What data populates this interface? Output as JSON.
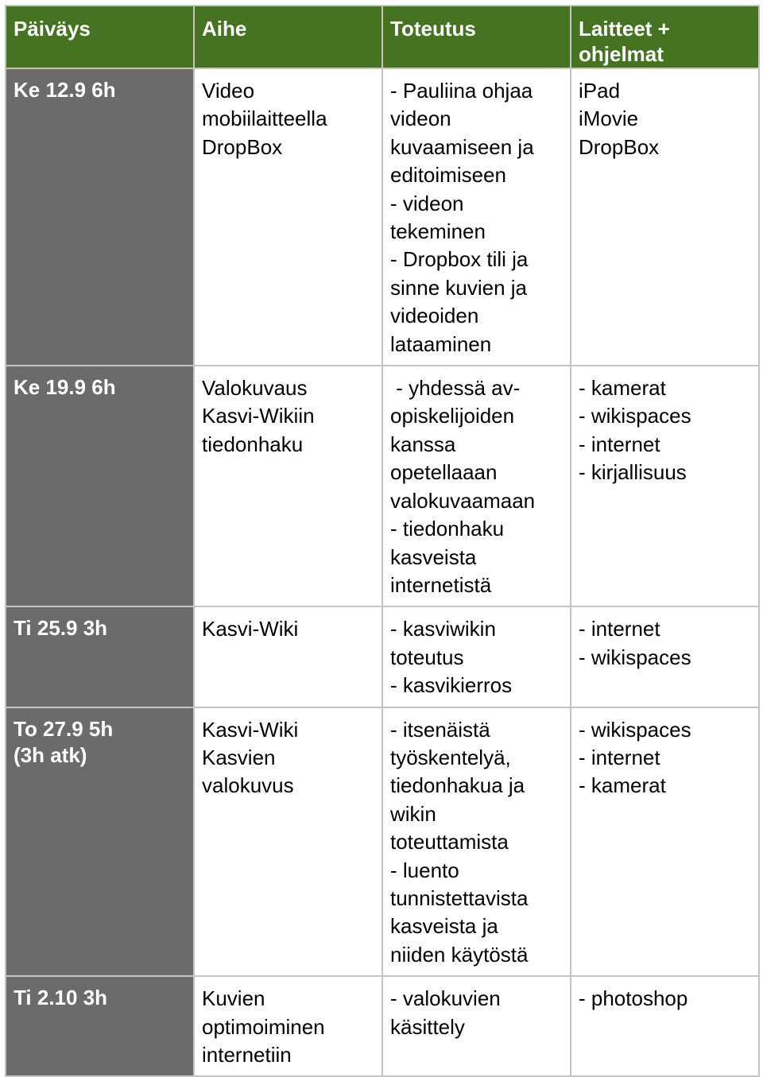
{
  "colors": {
    "header_bg": "#467321",
    "date_column_bg": "#6b6b6b",
    "border": "#c4c4c4"
  },
  "table": {
    "headers": [
      "Päiväys",
      "Aihe",
      "Toteutus",
      "Laitteet + ohjelmat"
    ],
    "rows": [
      {
        "date": [
          "Ke 12.9 6h"
        ],
        "topic": [
          "Video",
          "mobiilaitteella",
          "DropBox"
        ],
        "implementation": [
          "- Pauliina ohjaa",
          "videon",
          "kuvaamiseen ja",
          "editoimiseen",
          "- videon",
          "tekeminen",
          "- Dropbox tili ja",
          "sinne kuvien ja",
          "videoiden",
          "lataaminen"
        ],
        "tools": [
          "iPad",
          "iMovie",
          "DropBox"
        ]
      },
      {
        "date": [
          "Ke 19.9 6h"
        ],
        "topic": [
          "Valokuvaus",
          "Kasvi-Wikiin",
          "tiedonhaku"
        ],
        "implementation": [
          " - yhdessä av-",
          "opiskelijoiden",
          "kanssa",
          "opetellaaan",
          "valokuvaamaan",
          "- tiedonhaku",
          "kasveista",
          "internetistä"
        ],
        "tools": [
          "- kamerat",
          "- wikispaces",
          "- internet",
          "- kirjallisuus"
        ]
      },
      {
        "date": [
          "Ti 25.9 3h"
        ],
        "topic": [
          "Kasvi-Wiki"
        ],
        "implementation": [
          "- kasviwikin",
          "toteutus",
          "- kasvikierros"
        ],
        "tools": [
          "- internet",
          "- wikispaces"
        ]
      },
      {
        "date": [
          "To 27.9 5h",
          "(3h atk)"
        ],
        "topic": [
          "Kasvi-Wiki",
          "Kasvien",
          "valokuvus"
        ],
        "implementation": [
          "- itsenäistä",
          "työskentelyä,",
          "tiedonhakua ja",
          "wikin",
          "toteuttamista",
          "- luento",
          "tunnistettavista",
          "kasveista ja",
          "niiden käytöstä"
        ],
        "tools": [
          "- wikispaces",
          "- internet",
          "- kamerat"
        ]
      },
      {
        "date": [
          "Ti 2.10 3h"
        ],
        "topic": [
          "Kuvien",
          "optimoiminen",
          "internetiin"
        ],
        "implementation": [
          "- valokuvien",
          "käsittely"
        ],
        "tools": [
          "- photoshop"
        ]
      }
    ]
  }
}
